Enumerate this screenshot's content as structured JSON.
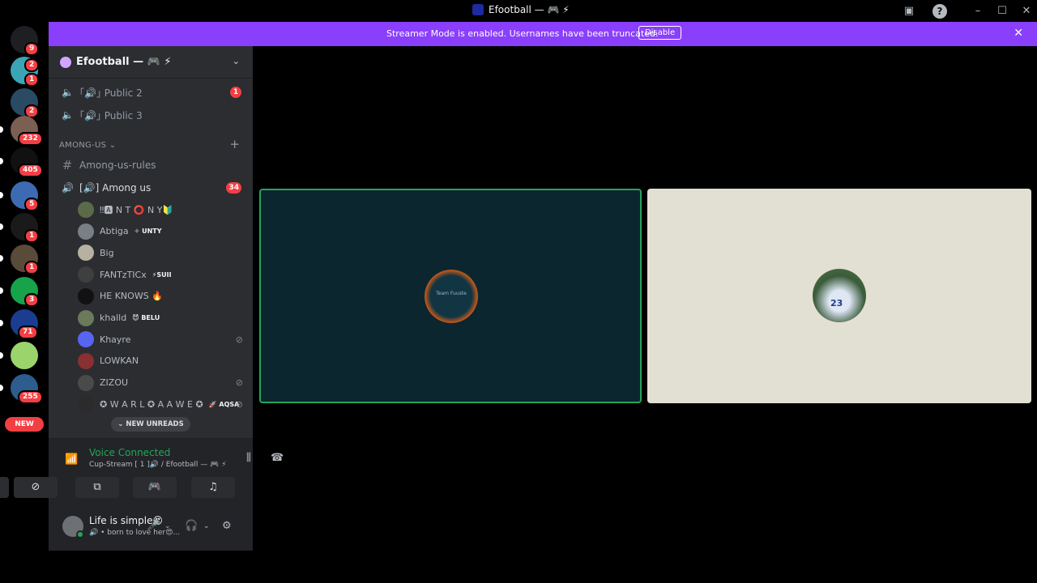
{
  "window": {
    "title": "Efootball — 🎮 ⚡"
  },
  "rail": {
    "servers": [
      {
        "name": "discord-home",
        "badge": "9",
        "color": "#1e1f22"
      },
      {
        "name": "server-1",
        "badge": "1",
        "badge2": "2",
        "color": "#3ba5b6"
      },
      {
        "name": "server-2",
        "badge": "2",
        "color": "#2a4a63"
      },
      {
        "name": "server-3",
        "badge": "232",
        "color": "#7a5f52"
      },
      {
        "name": "server-4",
        "badge": "405",
        "color": "#111111"
      },
      {
        "name": "server-5",
        "badge": "5",
        "color": "#3d6bb3"
      },
      {
        "name": "server-6",
        "badge": "1",
        "color": "#1a1a1a"
      },
      {
        "name": "server-7",
        "badge": "1",
        "color": "#5a4a3a"
      },
      {
        "name": "server-8",
        "badge": "3",
        "color": "#16a34a"
      },
      {
        "name": "server-9",
        "badge": "71",
        "color": "#1a3d8f"
      },
      {
        "name": "server-10",
        "badge": "",
        "color": "#9bd46b"
      },
      {
        "name": "server-11",
        "badge": "255",
        "color": "#2d5c8f"
      }
    ],
    "new_label": "NEW"
  },
  "banner": {
    "message": "Streamer Mode is enabled. Usernames have been truncated.",
    "disable_label": "Disable"
  },
  "sidebar": {
    "guild_name": "Efootball — 🎮 ⚡",
    "channels_top": [
      {
        "label": "｢🔊｣ Public 2",
        "badge": "1"
      },
      {
        "label": "｢🔊｣ Public 3",
        "badge": ""
      }
    ],
    "category": "AMONG-US",
    "text_channel": "Among-us-rules",
    "voice_channel": "[🔊] Among us",
    "voice_channel_badge": "34",
    "voice_users": [
      {
        "name": "‼🅰 N T ⭕ N Y🔰",
        "tag": "",
        "muted": false,
        "color": "#5b6b4a"
      },
      {
        "name": "Abtiga",
        "tag": "✧ UNTY",
        "muted": false,
        "color": "#7a7f85"
      },
      {
        "name": "Big",
        "tag": "",
        "muted": false,
        "color": "#b8b0a0"
      },
      {
        "name": "FANTzTICx",
        "tag": "⚡SUII",
        "muted": false,
        "color": "#3f3f3f"
      },
      {
        "name": "HE KNOWS 🔥",
        "tag": "",
        "muted": false,
        "color": "#111111"
      },
      {
        "name": "khalld",
        "tag": "😈 BELU",
        "muted": false,
        "color": "#6b7a5a"
      },
      {
        "name": "Khayre",
        "tag": "",
        "muted": true,
        "color": "#5865f2"
      },
      {
        "name": "LOWKAN",
        "tag": "",
        "muted": false,
        "color": "#8a3030"
      },
      {
        "name": "ZIZOU",
        "tag": "",
        "muted": true,
        "color": "#4a4a4a"
      },
      {
        "name": "✪ W A R L ✪ A A W E ✪",
        "tag": "🚀 AQSA",
        "muted": true,
        "color": "#2b2b2b"
      }
    ],
    "new_unreads": "NEW UNREADS"
  },
  "voice_panel": {
    "status": "Voice Connected",
    "subtitle": "Cup-Stream [ 1 ]🔊 / Efootball — 🎮 ⚡"
  },
  "user_panel": {
    "name": "Life is simple😍",
    "status": "🔊 • born to love her😍..."
  },
  "tiles": {
    "tile1_text": "Team Fuuste",
    "tile2_text": "23"
  }
}
